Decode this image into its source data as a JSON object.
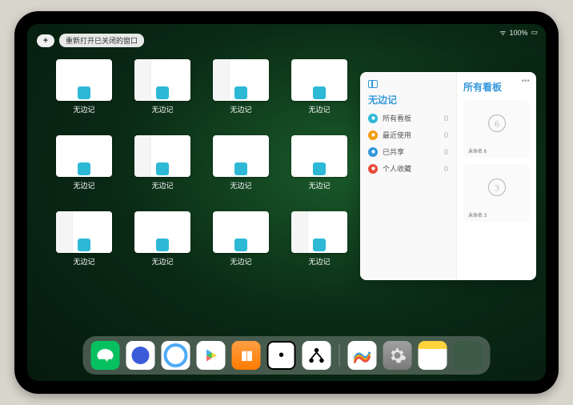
{
  "statusbar": {
    "wifi": "ᯤ",
    "battery_text": "100%",
    "signal": "•••"
  },
  "topbar": {
    "plus": "+",
    "reopen": "重新打开已关闭的窗口"
  },
  "window_label": "无边记",
  "window_count": 12,
  "detailed_indices": [
    1,
    2,
    5,
    8,
    11
  ],
  "popup": {
    "left_title": "无边记",
    "right_title": "所有看板",
    "items": [
      {
        "label": "所有看板",
        "count": 0,
        "color": "#2db8d6"
      },
      {
        "label": "最近使用",
        "count": 0,
        "color": "#f39c12"
      },
      {
        "label": "已共享",
        "count": 0,
        "color": "#3498db"
      },
      {
        "label": "个人收藏",
        "count": 0,
        "color": "#e74c3c"
      }
    ],
    "boards": [
      {
        "caption": "未命名 6",
        "glyph": "6"
      },
      {
        "caption": "未命名 3",
        "glyph": "3"
      }
    ]
  },
  "dock": {
    "icons": [
      {
        "name": "wechat-icon",
        "cls": "di-wechat"
      },
      {
        "name": "circle-solid-icon",
        "cls": "di-qsolid"
      },
      {
        "name": "circle-ring-icon",
        "cls": "di-qring"
      },
      {
        "name": "play-store-icon",
        "cls": "di-play"
      },
      {
        "name": "books-icon",
        "cls": "di-books"
      },
      {
        "name": "dice-icon",
        "cls": "di-die"
      },
      {
        "name": "hierarchy-icon",
        "cls": "di-hier"
      }
    ],
    "recent": [
      {
        "name": "freeform-icon",
        "cls": "di-freeform"
      },
      {
        "name": "settings-icon",
        "cls": "di-settings"
      },
      {
        "name": "notes-icon",
        "cls": "di-notes"
      },
      {
        "name": "app-folder-icon",
        "cls": "di-folder"
      }
    ]
  }
}
